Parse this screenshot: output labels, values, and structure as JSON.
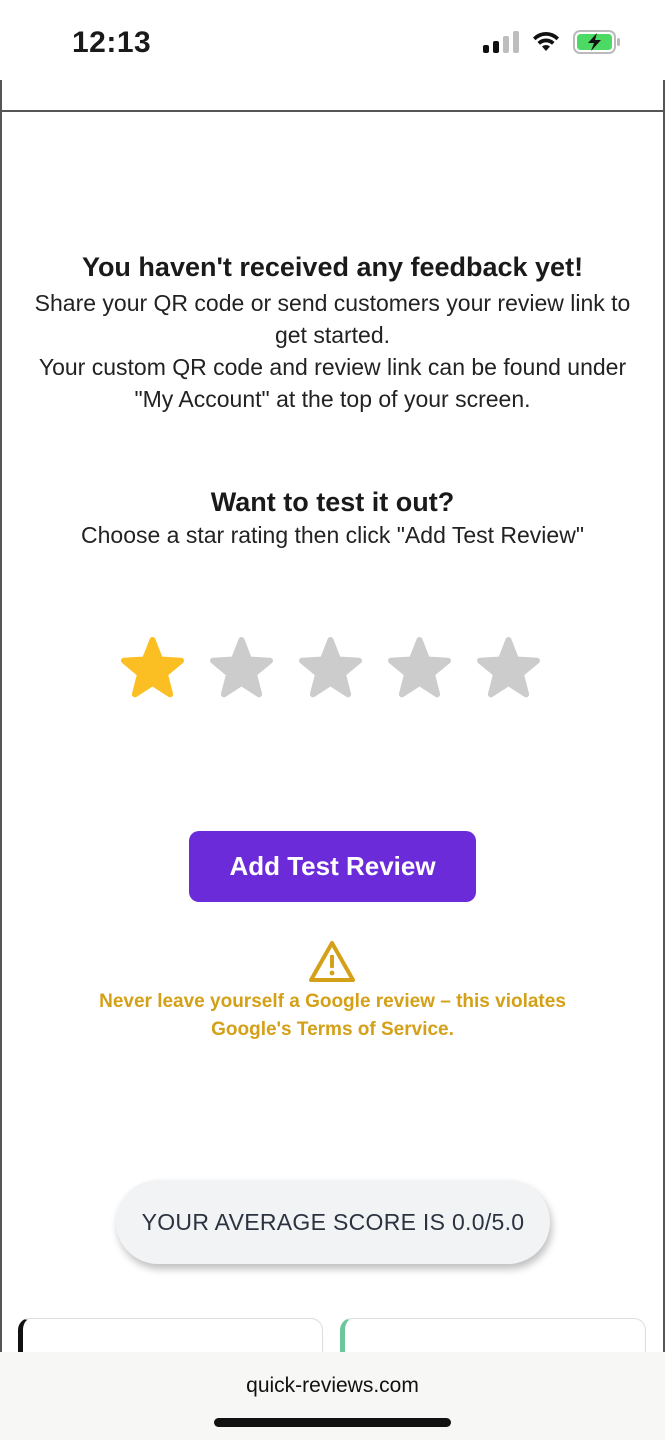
{
  "status_bar": {
    "time": "12:13",
    "signal_icon": "cellular-signal-icon",
    "wifi_icon": "wifi-icon",
    "battery_icon": "battery-charging-icon"
  },
  "empty_state": {
    "title": "You haven't received any feedback yet!",
    "line1": "Share your QR code or send customers your review link to get started.",
    "line2": "Your custom QR code and review link can be found under \"My Account\" at the top of your screen."
  },
  "test": {
    "title": "Want to test it out?",
    "subtitle": "Choose a star rating then click \"Add Test Review\"",
    "selected_rating": 1,
    "max_rating": 5,
    "active_color": "#fbbf24",
    "inactive_color": "#cccccc",
    "button_label": "Add Test Review",
    "button_color": "#6b2bd9"
  },
  "warning": {
    "icon": "warning-triangle-icon",
    "text": "Never leave yourself a Google review – this violates Google's Terms of Service.",
    "color": "#d4a017"
  },
  "score": {
    "label": "YOUR AVERAGE SCORE IS 0.0/5.0"
  },
  "browser": {
    "url": "quick-reviews.com"
  }
}
